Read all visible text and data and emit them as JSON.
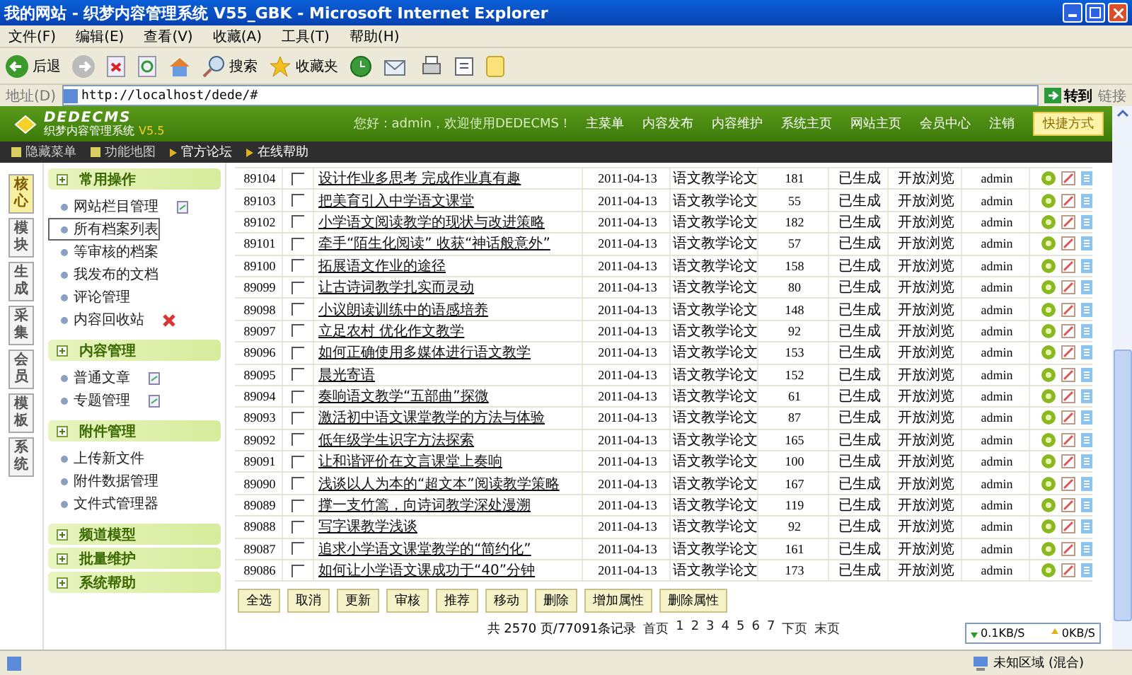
{
  "window": {
    "title": "我的网站 - 织梦内容管理系统 V55_GBK - Microsoft Internet Explorer"
  },
  "menu": [
    "文件(F)",
    "编辑(E)",
    "查看(V)",
    "收藏(A)",
    "工具(T)",
    "帮助(H)"
  ],
  "toolbar": {
    "back": "后退",
    "search": "搜索",
    "favorites": "收藏夹"
  },
  "address": {
    "label": "地址(D)",
    "url": "http://localhost/dede/#",
    "go": "转到",
    "links": "链接"
  },
  "header": {
    "logo": "DEDECMS",
    "subtitle": "织梦内容管理系统",
    "version": "V5.5",
    "welcome": "您好：admin，欢迎使用DEDECMS！",
    "nav": [
      "主菜单",
      "内容发布",
      "内容维护",
      "系统主页",
      "网站主页",
      "会员中心",
      "注销"
    ],
    "shortcut": "快捷方式"
  },
  "subbar": {
    "left": [
      "隐藏菜单",
      "功能地图"
    ],
    "right": [
      "官方论坛",
      "在线帮助"
    ]
  },
  "side_tabs": [
    {
      "label": "核心",
      "selected": true
    },
    {
      "label": "模块",
      "selected": false
    },
    {
      "label": "生成",
      "selected": false
    },
    {
      "label": "采集",
      "selected": false
    },
    {
      "label": "会员",
      "selected": false
    },
    {
      "label": "模板",
      "selected": false
    },
    {
      "label": "系统",
      "selected": false
    }
  ],
  "sidebar": [
    {
      "title": "常用操作",
      "items": [
        {
          "label": "网站栏目管理",
          "selected": false,
          "kind": "add"
        },
        {
          "label": "所有档案列表",
          "selected": true,
          "kind": "link"
        },
        {
          "label": "等审核的档案",
          "selected": false,
          "kind": "link"
        },
        {
          "label": "我发布的文档",
          "selected": false,
          "kind": "link"
        },
        {
          "label": "评论管理",
          "selected": false,
          "kind": "link"
        },
        {
          "label": "内容回收站",
          "selected": false,
          "kind": "delete"
        }
      ]
    },
    {
      "title": "内容管理",
      "items": [
        {
          "label": "普通文章",
          "selected": false,
          "kind": "add"
        },
        {
          "label": "专题管理",
          "selected": false,
          "kind": "add"
        }
      ]
    },
    {
      "title": "附件管理",
      "items": [
        {
          "label": "上传新文件",
          "selected": false,
          "kind": "link"
        },
        {
          "label": "附件数据管理",
          "selected": false,
          "kind": "link"
        },
        {
          "label": "文件式管理器",
          "selected": false,
          "kind": "link"
        }
      ]
    },
    {
      "title": "频道模型"
    },
    {
      "title": "批量维护"
    },
    {
      "title": "系统帮助"
    }
  ],
  "table": {
    "rows": [
      {
        "id": "89104",
        "checked": false,
        "title": "设计作业多思考 完成作业真有趣",
        "date": "2011-04-13",
        "category": "语文教学论文",
        "clicks": "181",
        "status": "已生成",
        "access": "开放浏览",
        "author": "admin"
      },
      {
        "id": "89103",
        "checked": false,
        "title": "把美育引入中学语文课堂",
        "date": "2011-04-13",
        "category": "语文教学论文",
        "clicks": "55",
        "status": "已生成",
        "access": "开放浏览",
        "author": "admin"
      },
      {
        "id": "89102",
        "checked": false,
        "title": "小学语文阅读教学的现状与改进策略",
        "date": "2011-04-13",
        "category": "语文教学论文",
        "clicks": "182",
        "status": "已生成",
        "access": "开放浏览",
        "author": "admin"
      },
      {
        "id": "89101",
        "checked": false,
        "title": "牵手“陌生化阅读” 收获“神话般意外”",
        "date": "2011-04-13",
        "category": "语文教学论文",
        "clicks": "57",
        "status": "已生成",
        "access": "开放浏览",
        "author": "admin"
      },
      {
        "id": "89100",
        "checked": false,
        "title": "拓展语文作业的途径",
        "date": "2011-04-13",
        "category": "语文教学论文",
        "clicks": "158",
        "status": "已生成",
        "access": "开放浏览",
        "author": "admin"
      },
      {
        "id": "89099",
        "checked": false,
        "title": "让古诗词教学扎实而灵动",
        "date": "2011-04-13",
        "category": "语文教学论文",
        "clicks": "80",
        "status": "已生成",
        "access": "开放浏览",
        "author": "admin"
      },
      {
        "id": "89098",
        "checked": false,
        "title": "小议朗读训练中的语感培养",
        "date": "2011-04-13",
        "category": "语文教学论文",
        "clicks": "148",
        "status": "已生成",
        "access": "开放浏览",
        "author": "admin"
      },
      {
        "id": "89097",
        "checked": false,
        "title": "立足农村 优化作文教学",
        "date": "2011-04-13",
        "category": "语文教学论文",
        "clicks": "92",
        "status": "已生成",
        "access": "开放浏览",
        "author": "admin"
      },
      {
        "id": "89096",
        "checked": false,
        "title": "如何正确使用多媒体进行语文教学",
        "date": "2011-04-13",
        "category": "语文教学论文",
        "clicks": "153",
        "status": "已生成",
        "access": "开放浏览",
        "author": "admin"
      },
      {
        "id": "89095",
        "checked": false,
        "title": "晨光寄语",
        "date": "2011-04-13",
        "category": "语文教学论文",
        "clicks": "152",
        "status": "已生成",
        "access": "开放浏览",
        "author": "admin"
      },
      {
        "id": "89094",
        "checked": false,
        "title": "奏响语文教学“五部曲”探微",
        "date": "2011-04-13",
        "category": "语文教学论文",
        "clicks": "61",
        "status": "已生成",
        "access": "开放浏览",
        "author": "admin"
      },
      {
        "id": "89093",
        "checked": false,
        "title": "激活初中语文课堂教学的方法与体验",
        "date": "2011-04-13",
        "category": "语文教学论文",
        "clicks": "87",
        "status": "已生成",
        "access": "开放浏览",
        "author": "admin"
      },
      {
        "id": "89092",
        "checked": false,
        "title": "低年级学生识字方法探索",
        "date": "2011-04-13",
        "category": "语文教学论文",
        "clicks": "165",
        "status": "已生成",
        "access": "开放浏览",
        "author": "admin"
      },
      {
        "id": "89091",
        "checked": false,
        "title": "让和谐评价在文言课堂上奏响",
        "date": "2011-04-13",
        "category": "语文教学论文",
        "clicks": "100",
        "status": "已生成",
        "access": "开放浏览",
        "author": "admin"
      },
      {
        "id": "89090",
        "checked": false,
        "title": "浅谈以人为本的“超文本”阅读教学策略",
        "date": "2011-04-13",
        "category": "语文教学论文",
        "clicks": "167",
        "status": "已生成",
        "access": "开放浏览",
        "author": "admin"
      },
      {
        "id": "89089",
        "checked": false,
        "title": "撑一支竹篙，向诗词教学深处漫溯",
        "date": "2011-04-13",
        "category": "语文教学论文",
        "clicks": "119",
        "status": "已生成",
        "access": "开放浏览",
        "author": "admin"
      },
      {
        "id": "89088",
        "checked": false,
        "title": "写字课教学浅谈",
        "date": "2011-04-13",
        "category": "语文教学论文",
        "clicks": "92",
        "status": "已生成",
        "access": "开放浏览",
        "author": "admin"
      },
      {
        "id": "89087",
        "checked": false,
        "title": "追求小学语文课堂教学的“简约化”",
        "date": "2011-04-13",
        "category": "语文教学论文",
        "clicks": "161",
        "status": "已生成",
        "access": "开放浏览",
        "author": "admin"
      },
      {
        "id": "89086",
        "checked": false,
        "title": "如何让小学语文课成功于“40”分钟",
        "date": "2011-04-13",
        "category": "语文教学论文",
        "clicks": "173",
        "status": "已生成",
        "access": "开放浏览",
        "author": "admin"
      }
    ]
  },
  "actions": [
    "全选",
    "取消",
    "更新",
    "审核",
    "推荐",
    "移动",
    "删除",
    "增加属性",
    "删除属性"
  ],
  "pagination": {
    "summary": "共 2570 页/77091条记录",
    "first": "首页",
    "pages": [
      "1",
      "2",
      "3",
      "4",
      "5",
      "6",
      "7"
    ],
    "next": "下页",
    "last": "末页"
  },
  "speed": {
    "down": "0.1KB/S",
    "up": "0KB/S"
  },
  "status_bar": {
    "zone": "未知区域 (混合)"
  }
}
